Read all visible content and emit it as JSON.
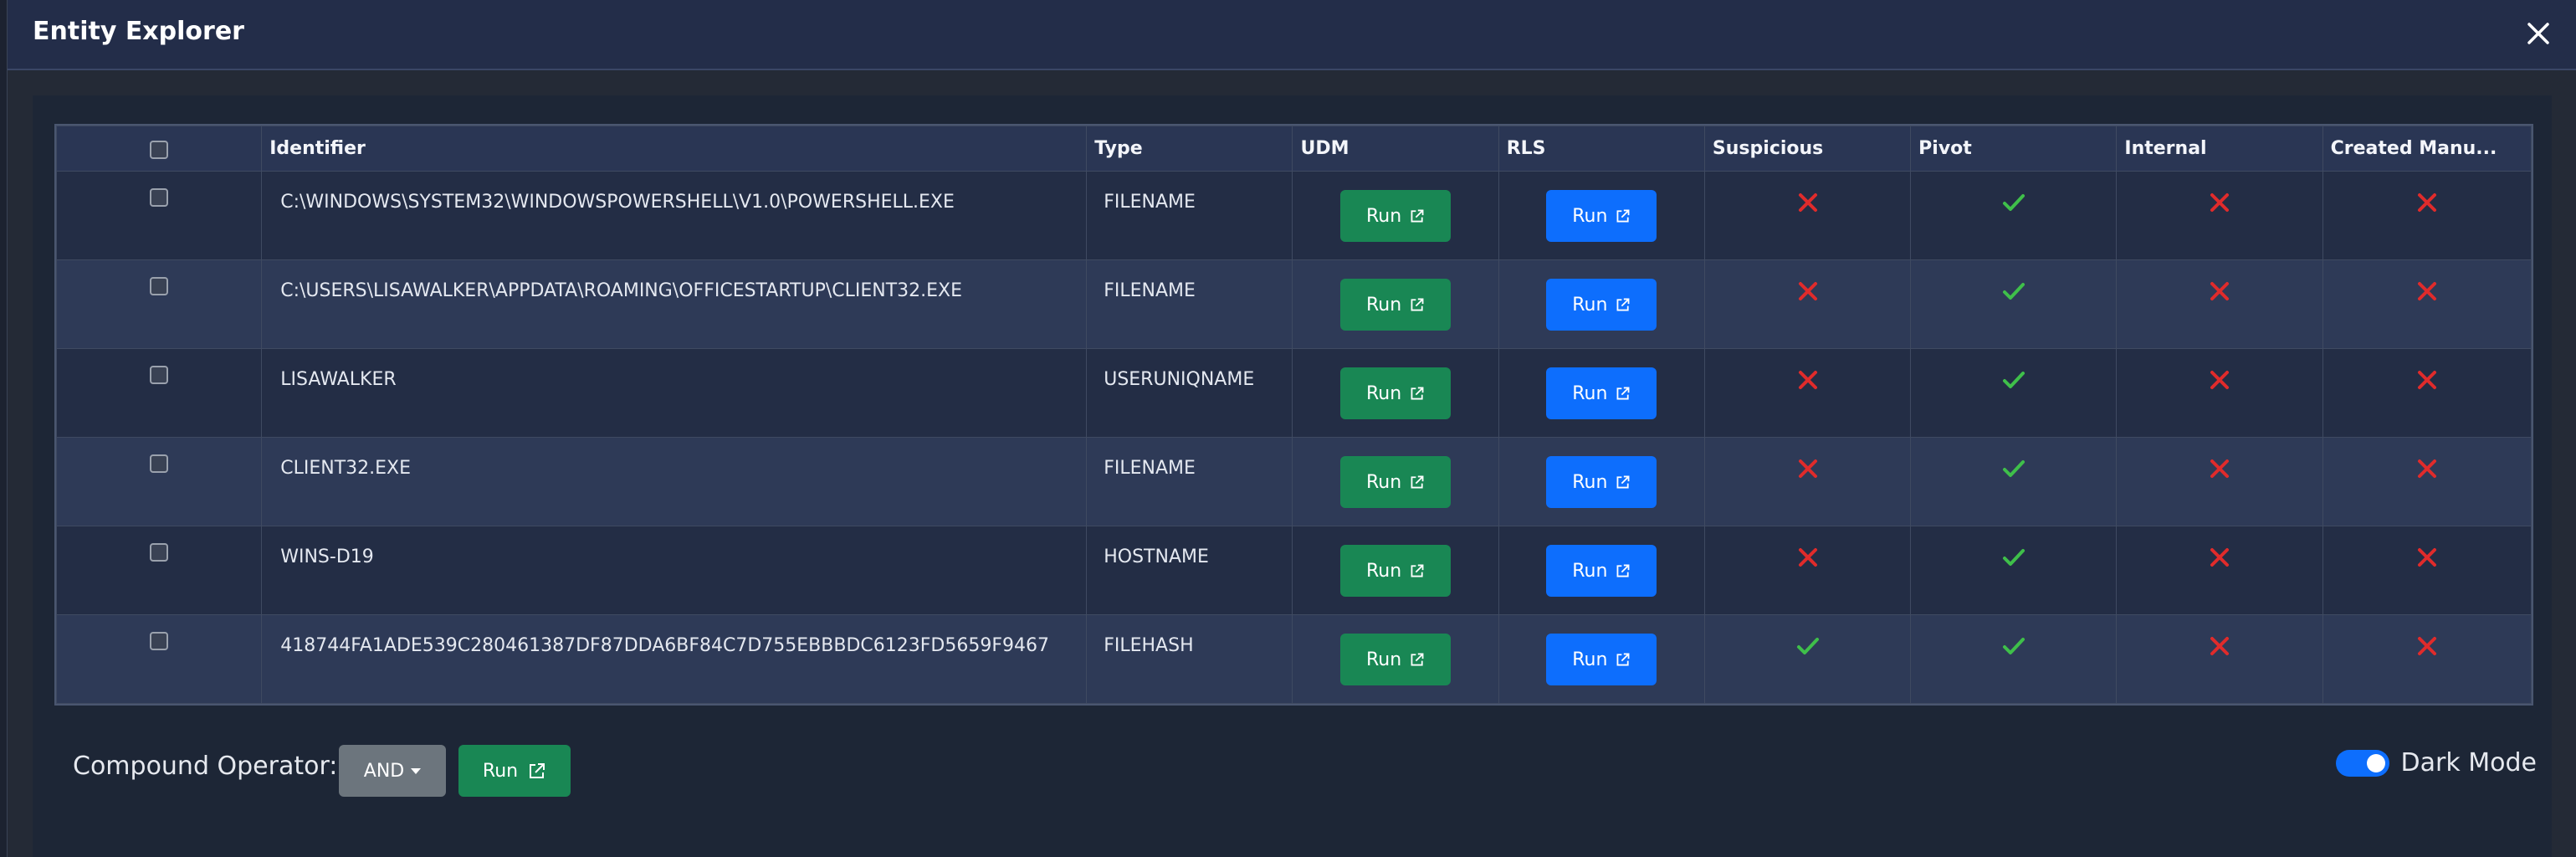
{
  "modal": {
    "title": "Entity Explorer"
  },
  "table": {
    "headers": [
      "",
      "Identifier",
      "Type",
      "UDM",
      "RLS",
      "Suspicious",
      "Pivot",
      "Internal",
      "Created Manu..."
    ],
    "rows": [
      {
        "identifier": "C:\\WINDOWS\\SYSTEM32\\WINDOWSPOWERSHELL\\V1.0\\POWERSHELL.EXE",
        "type": "FILENAME",
        "udm": "Run",
        "rls": "Run",
        "suspicious": false,
        "pivot": true,
        "internal": false,
        "created_manually": false
      },
      {
        "identifier": "C:\\USERS\\LISAWALKER\\APPDATA\\ROAMING\\OFFICESTARTUP\\CLIENT32.EXE",
        "type": "FILENAME",
        "udm": "Run",
        "rls": "Run",
        "suspicious": false,
        "pivot": true,
        "internal": false,
        "created_manually": false
      },
      {
        "identifier": "LISAWALKER",
        "type": "USERUNIQNAME",
        "udm": "Run",
        "rls": "Run",
        "suspicious": false,
        "pivot": true,
        "internal": false,
        "created_manually": false
      },
      {
        "identifier": "CLIENT32.EXE",
        "type": "FILENAME",
        "udm": "Run",
        "rls": "Run",
        "suspicious": false,
        "pivot": true,
        "internal": false,
        "created_manually": false
      },
      {
        "identifier": "WINS-D19",
        "type": "HOSTNAME",
        "udm": "Run",
        "rls": "Run",
        "suspicious": false,
        "pivot": true,
        "internal": false,
        "created_manually": false
      },
      {
        "identifier": "418744FA1ADE539C280461387DF87DDA6BF84C7D755EBBBDC6123FD5659F9467",
        "type": "FILEHASH",
        "udm": "Run",
        "rls": "Run",
        "suspicious": true,
        "pivot": true,
        "internal": false,
        "created_manually": false
      }
    ]
  },
  "footer": {
    "compound_label": "Compound Operator:",
    "operator_value": "AND",
    "run_label": "Run",
    "dark_mode_label": "Dark Mode",
    "dark_mode_on": true
  },
  "colors": {
    "green": "#198754",
    "blue": "#0d6efd",
    "check": "#3fbf4a",
    "cross": "#e02b2b"
  },
  "icons": {
    "close": "close-icon",
    "external": "external-link-icon",
    "check": "check-icon",
    "cross": "x-icon",
    "caret": "caret-down-icon"
  }
}
